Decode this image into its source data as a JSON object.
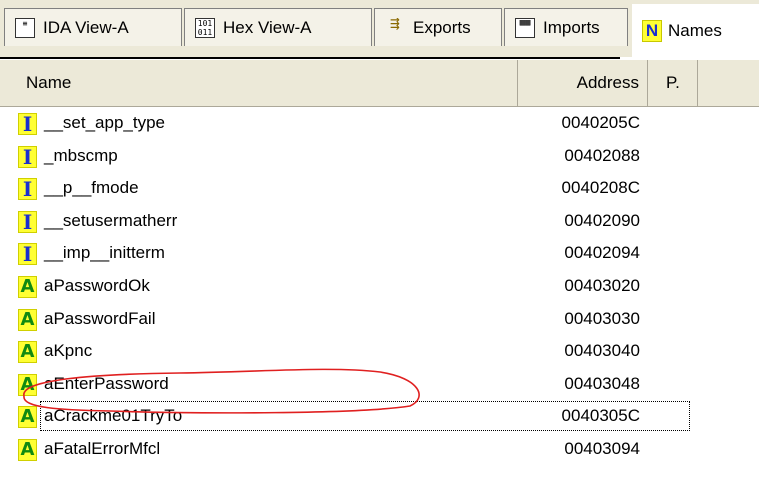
{
  "tabs": [
    {
      "label": "IDA View-A",
      "icon": "ida-view-icon"
    },
    {
      "label": "Hex View-A",
      "icon": "hex-view-icon"
    },
    {
      "label": "Exports",
      "icon": "exports-icon"
    },
    {
      "label": "Imports",
      "icon": "imports-icon"
    },
    {
      "label": "Names",
      "icon": "names-icon",
      "icon_letter": "N"
    }
  ],
  "columns": {
    "name": "Name",
    "address": "Address",
    "p": "P."
  },
  "rows": [
    {
      "icon": "I",
      "type": "import",
      "name": "__set_app_type",
      "address": "0040205C"
    },
    {
      "icon": "I",
      "type": "import",
      "name": "_mbscmp",
      "address": "00402088"
    },
    {
      "icon": "I",
      "type": "import",
      "name": "__p__fmode",
      "address": "0040208C"
    },
    {
      "icon": "I",
      "type": "import",
      "name": "__setusermatherr",
      "address": "00402090"
    },
    {
      "icon": "I",
      "type": "import",
      "name": "__imp__initterm",
      "address": "00402094"
    },
    {
      "icon": "A",
      "type": "string",
      "name": "aPasswordOk",
      "address": "00403020"
    },
    {
      "icon": "A",
      "type": "string",
      "name": "aPasswordFail",
      "address": "00403030"
    },
    {
      "icon": "A",
      "type": "string",
      "name": "aKpnc",
      "address": "00403040"
    },
    {
      "icon": "A",
      "type": "string",
      "name": "aEnterPassword",
      "address": "00403048"
    },
    {
      "icon": "A",
      "type": "string",
      "name": "aCrackme01TryTo",
      "address": "0040305C"
    },
    {
      "icon": "A",
      "type": "string",
      "name": "aFatalErrorMfcl",
      "address": "00403094"
    }
  ],
  "colors": {
    "import_icon": "#1a2fd0",
    "string_icon": "#118a11",
    "icon_bg": "#ffff33",
    "annotation": "#e02020"
  }
}
